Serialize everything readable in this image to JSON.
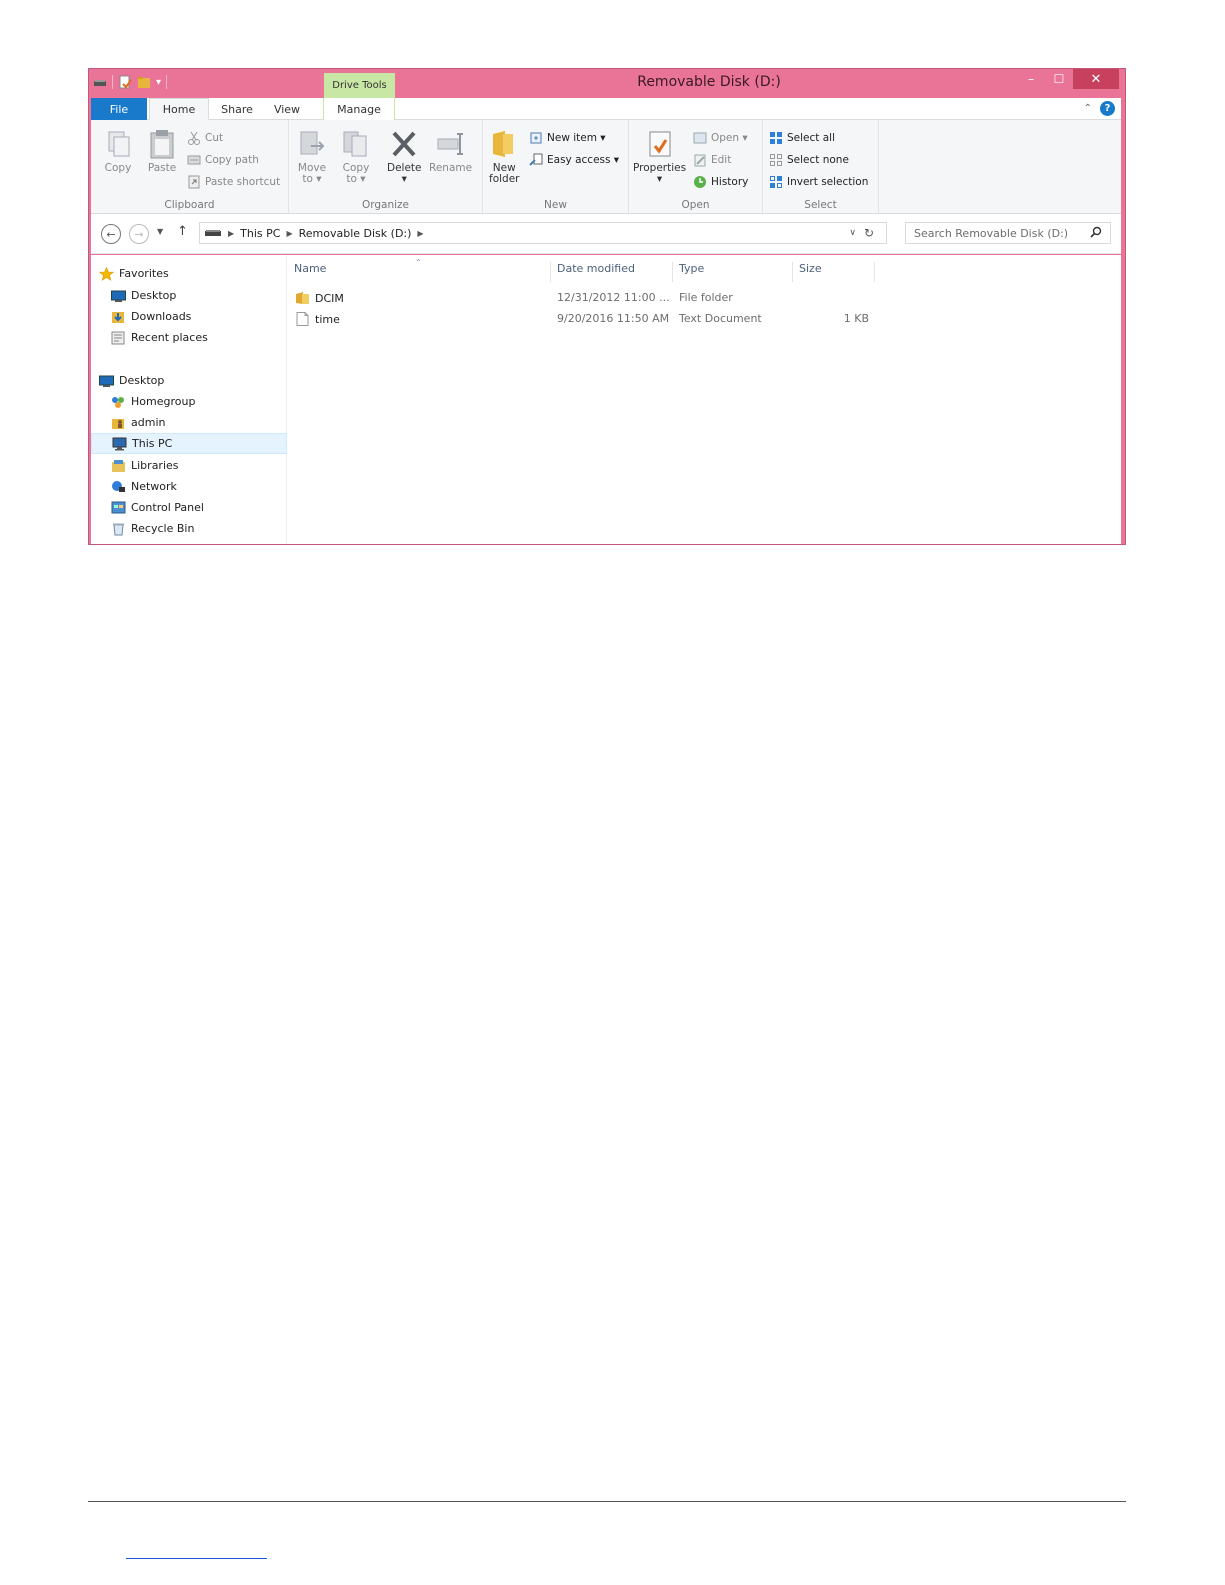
{
  "window": {
    "title": "Removable Disk (D:)",
    "context_tab_group": "Drive Tools",
    "colors": {
      "frame": "#e97497",
      "context_tab": "#c8e6a4",
      "file_tab": "#1979ca"
    }
  },
  "ribbon": {
    "tabs": [
      "File",
      "Home",
      "Share",
      "View",
      "Manage"
    ],
    "active_tab": "Home",
    "clipboard": {
      "label": "Clipboard",
      "copy": "Copy",
      "paste": "Paste",
      "cut": "Cut",
      "copy_path": "Copy path",
      "paste_shortcut": "Paste shortcut"
    },
    "organize": {
      "label": "Organize",
      "move_to_1": "Move",
      "move_to_2": "to ▾",
      "copy_to_1": "Copy",
      "copy_to_2": "to ▾",
      "delete": "Delete",
      "delete_caret": "▾",
      "rename": "Rename"
    },
    "new": {
      "label": "New",
      "new_folder_1": "New",
      "new_folder_2": "folder",
      "new_item": "New item ▾",
      "easy_access": "Easy access ▾"
    },
    "open": {
      "label": "Open",
      "properties": "Properties",
      "properties_caret": "▾",
      "open": "Open ▾",
      "edit": "Edit",
      "history": "History"
    },
    "select": {
      "label": "Select",
      "select_all": "Select all",
      "select_none": "Select none",
      "invert_selection": "Invert selection"
    }
  },
  "address": {
    "breadcrumbs": [
      "This PC",
      "Removable Disk (D:)"
    ],
    "search_placeholder": "Search Removable Disk (D:)"
  },
  "nav_pane": {
    "items": [
      {
        "label": "Favorites",
        "icon": "star-icon"
      },
      {
        "label": "Desktop",
        "icon": "desktop-icon"
      },
      {
        "label": "Downloads",
        "icon": "downloads-icon"
      },
      {
        "label": "Recent places",
        "icon": "recent-places-icon"
      },
      {
        "label": "Desktop",
        "icon": "desktop-icon"
      },
      {
        "label": "Homegroup",
        "icon": "homegroup-icon"
      },
      {
        "label": "admin",
        "icon": "user-folder-icon"
      },
      {
        "label": "This PC",
        "icon": "computer-icon"
      },
      {
        "label": "Libraries",
        "icon": "libraries-icon"
      },
      {
        "label": "Network",
        "icon": "network-icon"
      },
      {
        "label": "Control Panel",
        "icon": "control-panel-icon"
      },
      {
        "label": "Recycle Bin",
        "icon": "recycle-bin-icon"
      }
    ],
    "selected": "This PC"
  },
  "file_list": {
    "columns": [
      "Name",
      "Date modified",
      "Type",
      "Size"
    ],
    "rows": [
      {
        "name": "DCIM",
        "date": "12/31/2012 11:00 ...",
        "type": "File folder",
        "size": "",
        "icon": "folder-icon"
      },
      {
        "name": "time",
        "date": "9/20/2016 11:50 AM",
        "type": "Text Document",
        "size": "1 KB",
        "icon": "text-file-icon"
      }
    ]
  }
}
